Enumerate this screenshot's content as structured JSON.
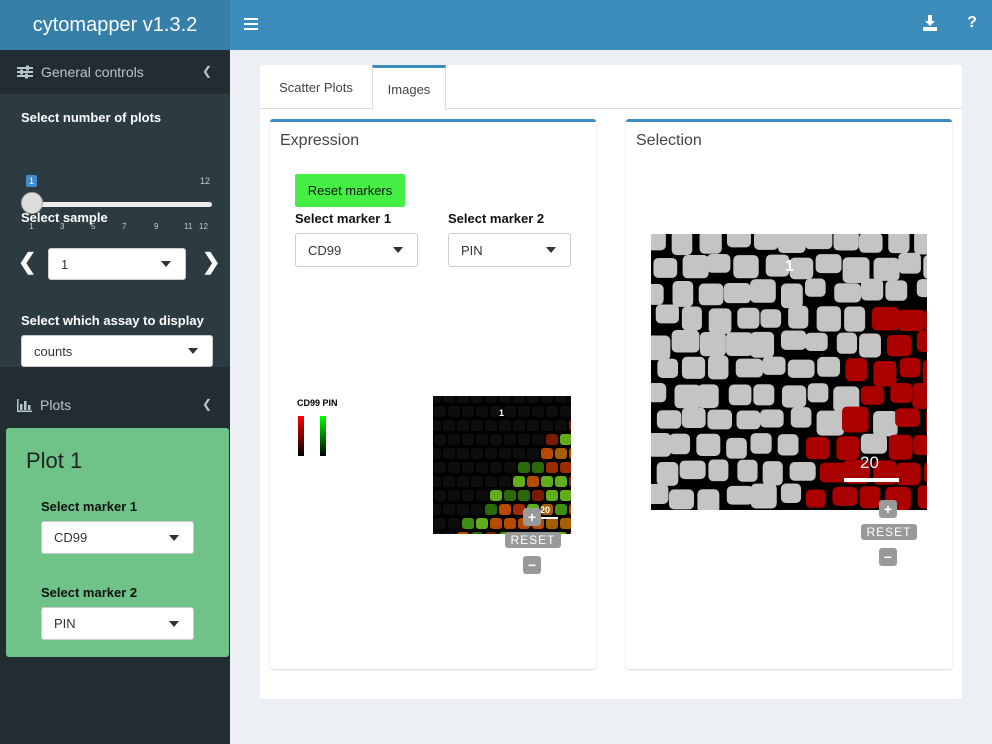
{
  "app": {
    "title": "cytomapper v1.3.2"
  },
  "navbar": {
    "download_icon": "download-icon",
    "help_label": "?"
  },
  "sidebar": {
    "general_controls": {
      "label": "General controls",
      "icon": "sliders-icon",
      "num_plots_label": "Select number of plots",
      "slider_value": "1",
      "slider_max": "12",
      "slider_ticks": [
        "1",
        "3",
        "5",
        "7",
        "9",
        "11",
        "12"
      ],
      "sample_label": "Select sample",
      "sample_value": "1",
      "assay_label": "Select which assay to display",
      "assay_value": "counts"
    },
    "plots": {
      "label": "Plots",
      "icon": "bar-chart-icon"
    },
    "plot1": {
      "title": "Plot 1",
      "marker1_label": "Select marker 1",
      "marker1_value": "CD99",
      "marker2_label": "Select marker 2",
      "marker2_value": "PIN"
    }
  },
  "tabs": [
    {
      "label": "Scatter Plots"
    },
    {
      "label": "Images"
    }
  ],
  "expression": {
    "title": "Expression",
    "reset_button": "Reset markers",
    "marker1_label": "Select marker 1",
    "marker1_value": "CD99",
    "marker2_label": "Select marker 2",
    "marker2_value": "PIN",
    "legend_title": "CD99 PIN",
    "image_label": "1",
    "scale_label": "20",
    "reset_label": "RESET",
    "zoom_in": "+",
    "zoom_out": "−"
  },
  "selection": {
    "title": "Selection",
    "image_label": "1",
    "scale_label": "20",
    "reset_label": "RESET",
    "zoom_in": "+",
    "zoom_out": "−"
  },
  "colors": {
    "header": "#3c8dbc",
    "logo": "#367fa9",
    "sidebar": "#222d32",
    "plot_box": "#6fc388",
    "reset_markers": "#44ee44",
    "selected_cells": "#aa0000"
  }
}
